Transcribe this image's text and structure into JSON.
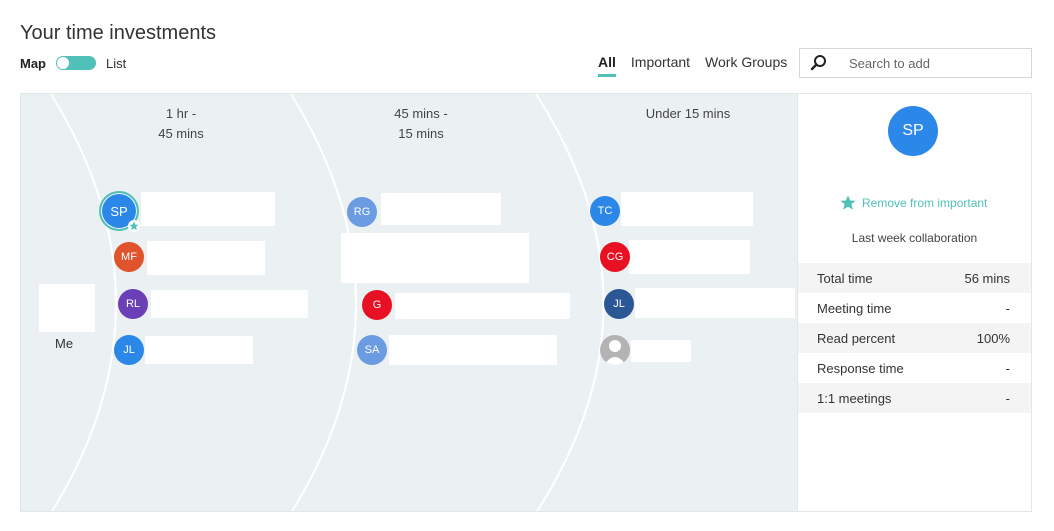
{
  "page": {
    "title": "Your time investments",
    "toggle": {
      "left_label": "Map",
      "right_label": "List"
    },
    "tabs": [
      {
        "label": "All",
        "active": true
      },
      {
        "label": "Important",
        "active": false
      },
      {
        "label": "Work Groups",
        "active": false
      }
    ],
    "search": {
      "placeholder": "Search to add",
      "icon": "search-icon"
    }
  },
  "map": {
    "columns": [
      {
        "line1": "1 hr -",
        "line2": "45 mins"
      },
      {
        "line1": "45 mins -",
        "line2": "15 mins"
      },
      {
        "line1": "Under 15 mins",
        "line2": ""
      }
    ],
    "me_label": "Me",
    "people": [
      {
        "initials": "SP",
        "color": "#2b88e8",
        "selected": true,
        "important": true
      },
      {
        "initials": "MF",
        "color": "#e0532c"
      },
      {
        "initials": "RL",
        "color": "#6b3fb5"
      },
      {
        "initials": "JL",
        "color": "#2b88e8"
      },
      {
        "initials": "RG",
        "color": "#6b9be0"
      },
      {
        "initials": "G",
        "color": "#e81123"
      },
      {
        "initials": "SA",
        "color": "#6b9be0"
      },
      {
        "initials": "TC",
        "color": "#2b88e8"
      },
      {
        "initials": "CG",
        "color": "#e81123"
      },
      {
        "initials": "JL",
        "color": "#2b5797"
      },
      {
        "initials": "",
        "color": "#b3b3b3",
        "icon": "person-placeholder-icon"
      }
    ]
  },
  "panel": {
    "initials": "SP",
    "avatar_color": "#2b88e8",
    "remove_label": "Remove from important",
    "collab_label": "Last week collaboration",
    "stats": [
      {
        "label": "Total time",
        "value": "56 mins"
      },
      {
        "label": "Meeting time",
        "value": "-"
      },
      {
        "label": "Read percent",
        "value": "100%"
      },
      {
        "label": "Response time",
        "value": "-"
      },
      {
        "label": "1:1 meetings",
        "value": "-"
      }
    ]
  },
  "colors": {
    "accent": "#4fc1b8",
    "map_bg": "#ebf1f3"
  }
}
